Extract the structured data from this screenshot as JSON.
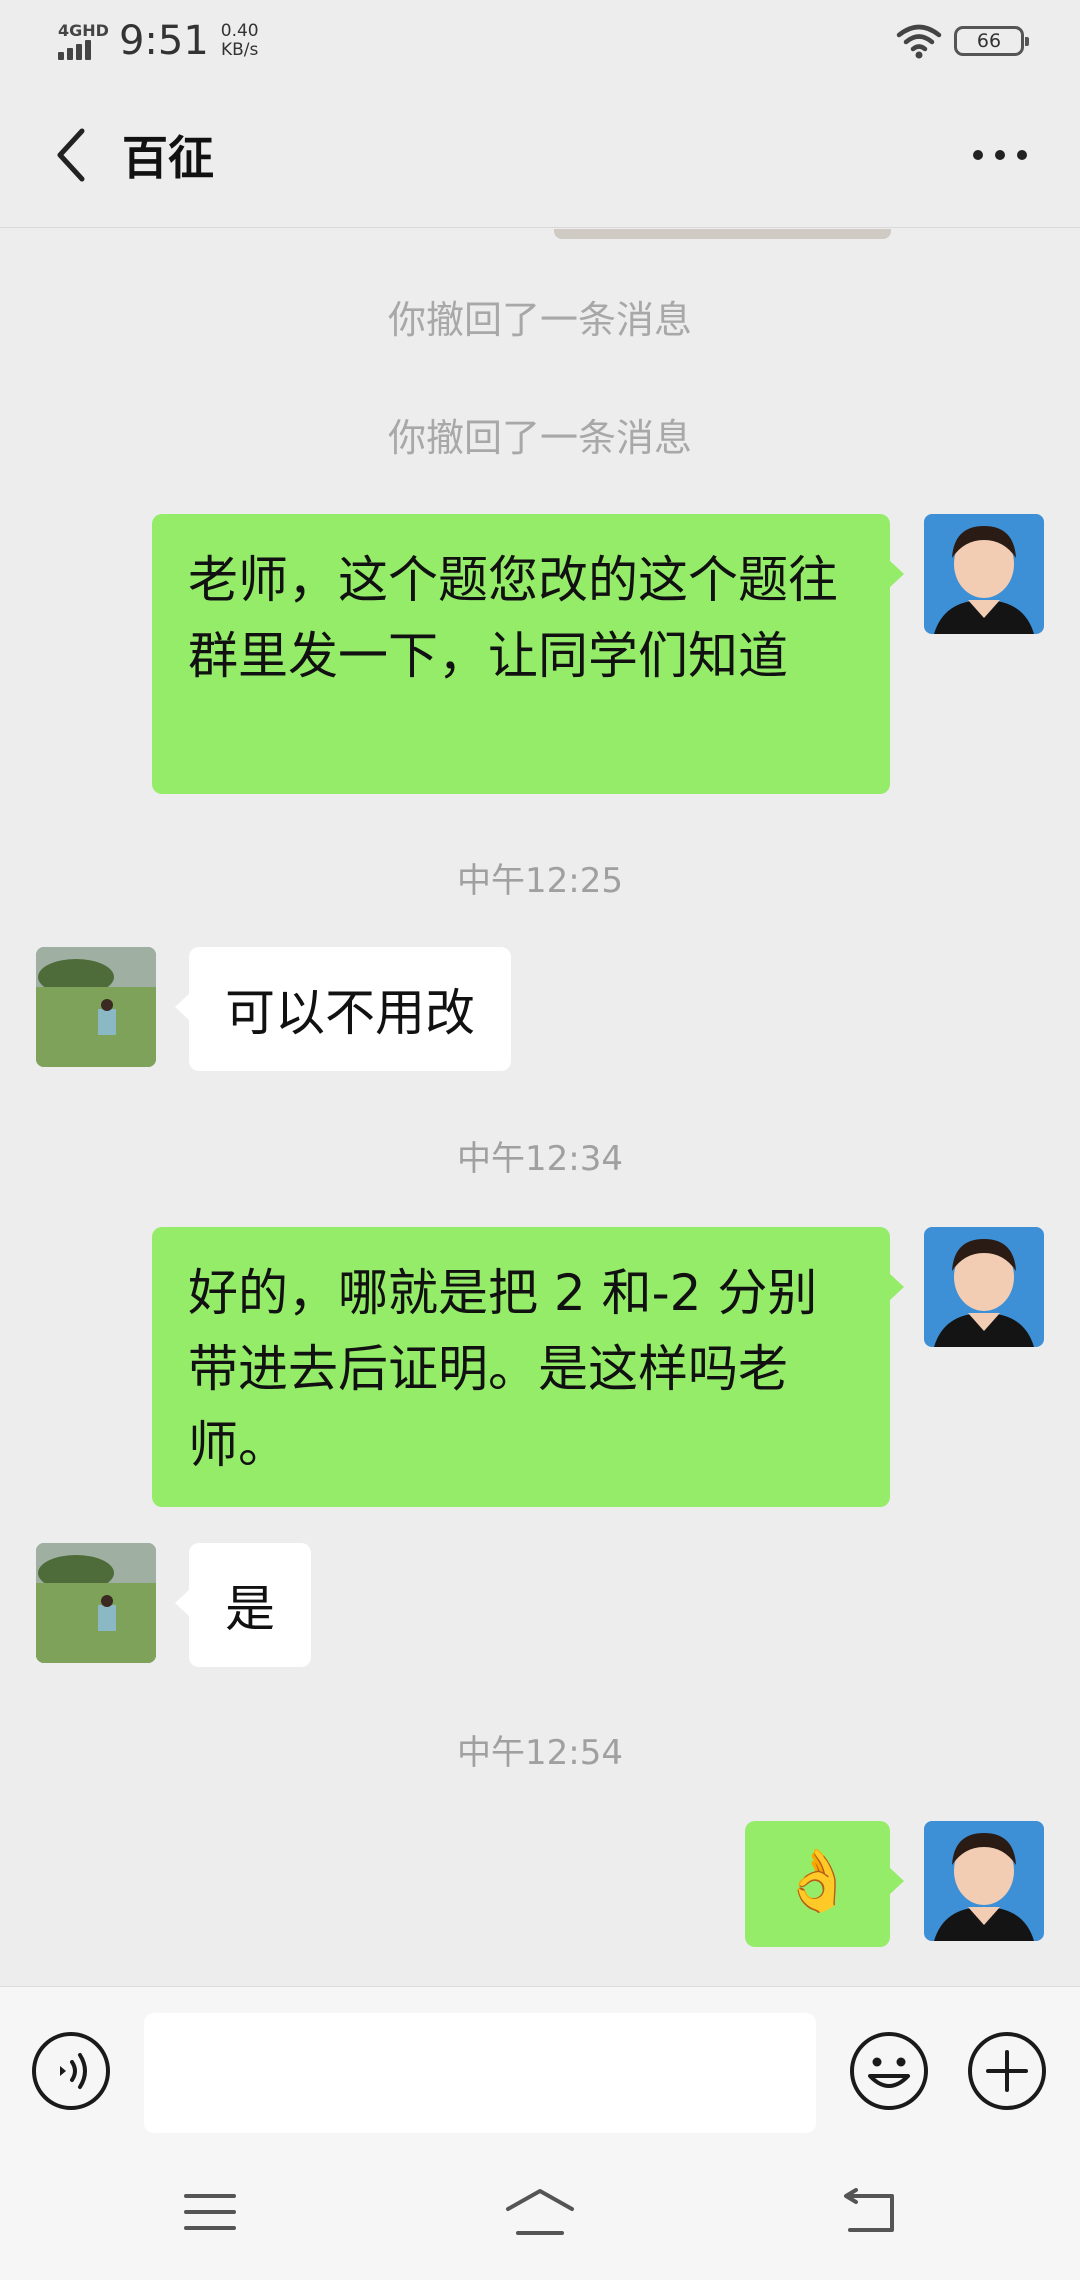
{
  "status_bar": {
    "network": "4GHD",
    "time": "9:51",
    "speed_value": "0.40",
    "speed_unit": "KB/s",
    "battery": "66"
  },
  "header": {
    "title": "百征"
  },
  "messages": {
    "recall_1": "你撤回了一条消息",
    "recall_2": "你撤回了一条消息",
    "msg_1": "老师，这个题您改的这个题往群里发一下，让同学们知道",
    "time_1": "中午12:25",
    "msg_2": "可以不用改",
    "time_2": "中午12:34",
    "msg_3": "好的，哪就是把 2 和-2 分别带进去后证明。是这样吗老师。",
    "msg_4": "是",
    "time_3": "中午12:54",
    "msg_5": "👌"
  },
  "colors": {
    "outgoing_bubble": "#95ec69",
    "incoming_bubble": "#ffffff",
    "background": "#ededed"
  },
  "icons": {
    "back": "chevron-left-icon",
    "more": "more-dots-icon",
    "voice": "voice-icon",
    "emoji": "emoji-face-icon",
    "plus": "plus-icon",
    "menu": "menu-icon",
    "home": "home-icon",
    "return": "return-icon"
  }
}
